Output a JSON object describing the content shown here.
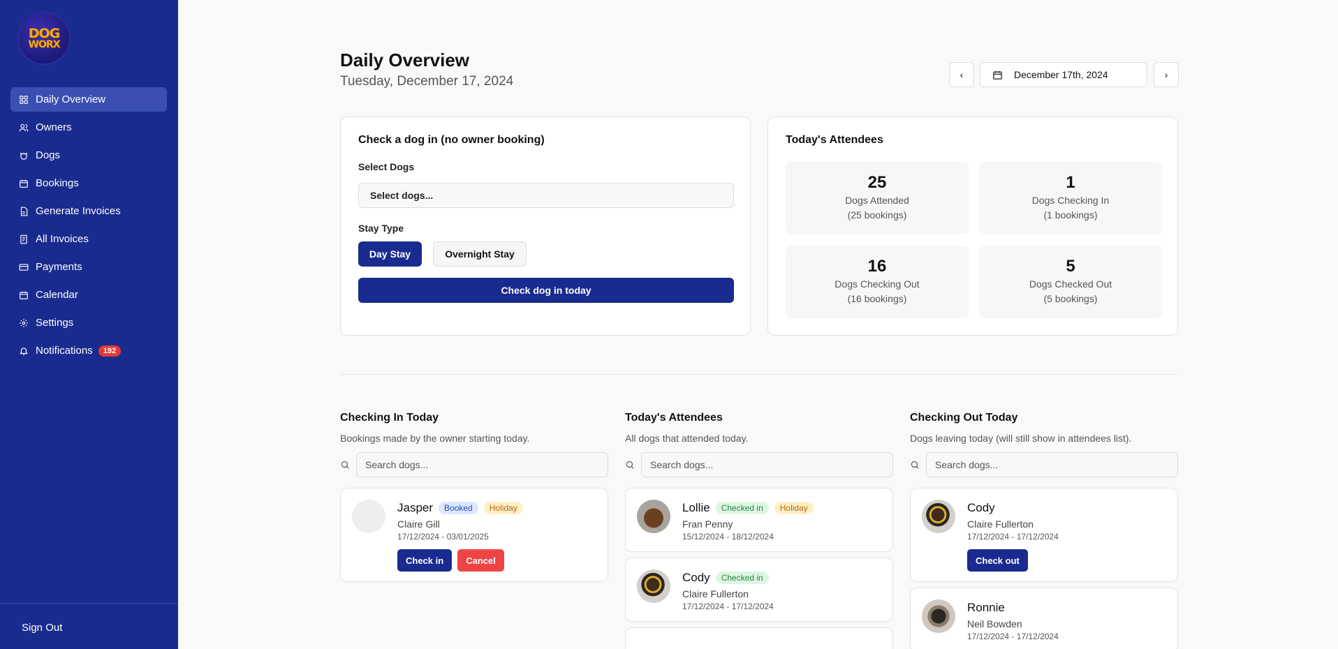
{
  "logo": {
    "line1": "DOG",
    "line2": "WORX"
  },
  "sidebar": {
    "items": [
      {
        "label": "Daily Overview",
        "icon": "grid-icon",
        "active": true
      },
      {
        "label": "Owners",
        "icon": "users-icon"
      },
      {
        "label": "Dogs",
        "icon": "paw-icon"
      },
      {
        "label": "Bookings",
        "icon": "calendar-icon"
      },
      {
        "label": "Generate Invoices",
        "icon": "file-icon"
      },
      {
        "label": "All Invoices",
        "icon": "receipt-icon"
      },
      {
        "label": "Payments",
        "icon": "credit-card-icon"
      },
      {
        "label": "Calendar",
        "icon": "calendar-icon"
      },
      {
        "label": "Settings",
        "icon": "gear-icon"
      },
      {
        "label": "Notifications",
        "icon": "bell-icon",
        "badge": "192"
      }
    ],
    "signout": "Sign Out"
  },
  "header": {
    "title": "Daily Overview",
    "subtitle": "Tuesday, December 17, 2024",
    "date": "December 17th, 2024"
  },
  "checkin_card": {
    "title": "Check a dog in (no owner booking)",
    "select_label": "Select Dogs",
    "select_placeholder": "Select dogs...",
    "stay_label": "Stay Type",
    "day_stay": "Day Stay",
    "overnight_stay": "Overnight Stay",
    "submit": "Check dog in today"
  },
  "attendees_card": {
    "title": "Today's Attendees",
    "stats": [
      {
        "num": "25",
        "label": "Dogs Attended",
        "sub": "(25 bookings)"
      },
      {
        "num": "1",
        "label": "Dogs Checking In",
        "sub": "(1 bookings)"
      },
      {
        "num": "16",
        "label": "Dogs Checking Out",
        "sub": "(16 bookings)"
      },
      {
        "num": "5",
        "label": "Dogs Checked Out",
        "sub": "(5 bookings)"
      }
    ]
  },
  "columns": {
    "checking_in": {
      "title": "Checking In Today",
      "desc": "Bookings made by the owner starting today.",
      "search_placeholder": "Search dogs...",
      "items": [
        {
          "name": "Jasper",
          "tags": [
            "Booked",
            "Holiday"
          ],
          "owner": "Claire Gill",
          "dates": "17/12/2024 - 03/01/2025",
          "checkin": "Check in",
          "cancel": "Cancel"
        }
      ]
    },
    "attendees": {
      "title": "Today's Attendees",
      "desc": "All dogs that attended today.",
      "search_placeholder": "Search dogs...",
      "items": [
        {
          "name": "Lollie",
          "tags": [
            "Checked in",
            "Holiday"
          ],
          "owner": "Fran Penny",
          "dates": "15/12/2024 - 18/12/2024"
        },
        {
          "name": "Cody",
          "tags": [
            "Checked in"
          ],
          "owner": "Claire Fullerton",
          "dates": "17/12/2024 - 17/12/2024"
        }
      ]
    },
    "checking_out": {
      "title": "Checking Out Today",
      "desc": "Dogs leaving today (will still show in attendees list).",
      "search_placeholder": "Search dogs...",
      "items": [
        {
          "name": "Cody",
          "owner": "Claire Fullerton",
          "dates": "17/12/2024 - 17/12/2024",
          "checkout": "Check out"
        },
        {
          "name": "Ronnie",
          "owner": "Neil Bowden",
          "dates": "17/12/2024 - 17/12/2024"
        }
      ]
    }
  },
  "colors": {
    "primary": "#1a2b8f",
    "danger": "#ef4444",
    "badge": "#e53935"
  }
}
